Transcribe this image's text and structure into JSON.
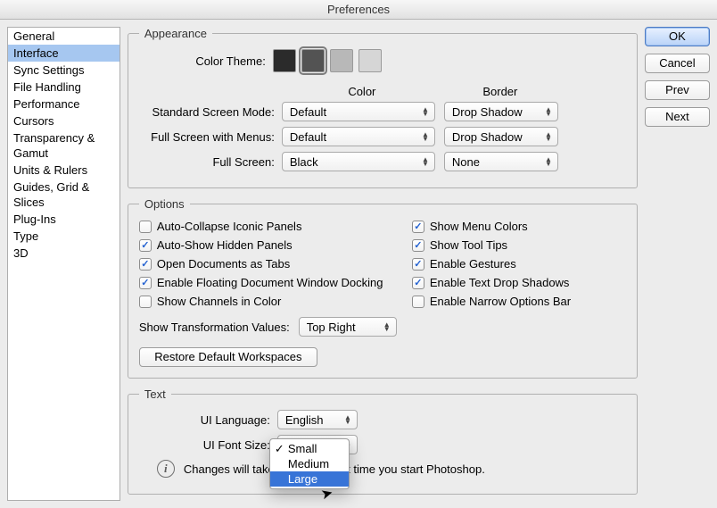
{
  "title": "Preferences",
  "sidebar": {
    "items": [
      {
        "label": "General"
      },
      {
        "label": "Interface",
        "selected": true
      },
      {
        "label": "Sync Settings"
      },
      {
        "label": "File Handling"
      },
      {
        "label": "Performance"
      },
      {
        "label": "Cursors"
      },
      {
        "label": "Transparency & Gamut"
      },
      {
        "label": "Units & Rulers"
      },
      {
        "label": "Guides, Grid & Slices"
      },
      {
        "label": "Plug-Ins"
      },
      {
        "label": "Type"
      },
      {
        "label": "3D"
      }
    ]
  },
  "buttons": {
    "ok": "OK",
    "cancel": "Cancel",
    "prev": "Prev",
    "next": "Next"
  },
  "appearance": {
    "legend": "Appearance",
    "color_theme_label": "Color Theme:",
    "swatches": [
      "#2b2b2b",
      "#535353",
      "#b8b8b8",
      "#d6d6d6"
    ],
    "header_color": "Color",
    "header_border": "Border",
    "rows": [
      {
        "label": "Standard Screen Mode:",
        "color": "Default",
        "border": "Drop Shadow"
      },
      {
        "label": "Full Screen with Menus:",
        "color": "Default",
        "border": "Drop Shadow"
      },
      {
        "label": "Full Screen:",
        "color": "Black",
        "border": "None"
      }
    ]
  },
  "options": {
    "legend": "Options",
    "checks": {
      "auto_collapse": {
        "label": "Auto-Collapse Iconic Panels",
        "checked": false
      },
      "show_menu_colors": {
        "label": "Show Menu Colors",
        "checked": true
      },
      "auto_show_hidden": {
        "label": "Auto-Show Hidden Panels",
        "checked": true
      },
      "show_tooltips": {
        "label": "Show Tool Tips",
        "checked": true
      },
      "open_docs_tabs": {
        "label": "Open Documents as Tabs",
        "checked": true
      },
      "enable_gestures": {
        "label": "Enable Gestures",
        "checked": true
      },
      "floating_dock": {
        "label": "Enable Floating Document Window Docking",
        "checked": true
      },
      "text_drop_shadows": {
        "label": "Enable Text Drop Shadows",
        "checked": true
      },
      "channels_color": {
        "label": "Show Channels in Color",
        "checked": false
      },
      "narrow_options": {
        "label": "Enable Narrow Options Bar",
        "checked": false
      }
    },
    "transform_label": "Show Transformation Values:",
    "transform_value": "Top Right",
    "restore_button": "Restore Default Workspaces"
  },
  "text": {
    "legend": "Text",
    "lang_label": "UI Language:",
    "lang_value": "English",
    "font_label": "UI Font Size:",
    "font_options": [
      "Small",
      "Medium",
      "Large"
    ],
    "font_selected": "Small",
    "font_highlighted": "Large",
    "info_text": "Changes will take effect the next time you start Photoshop."
  }
}
